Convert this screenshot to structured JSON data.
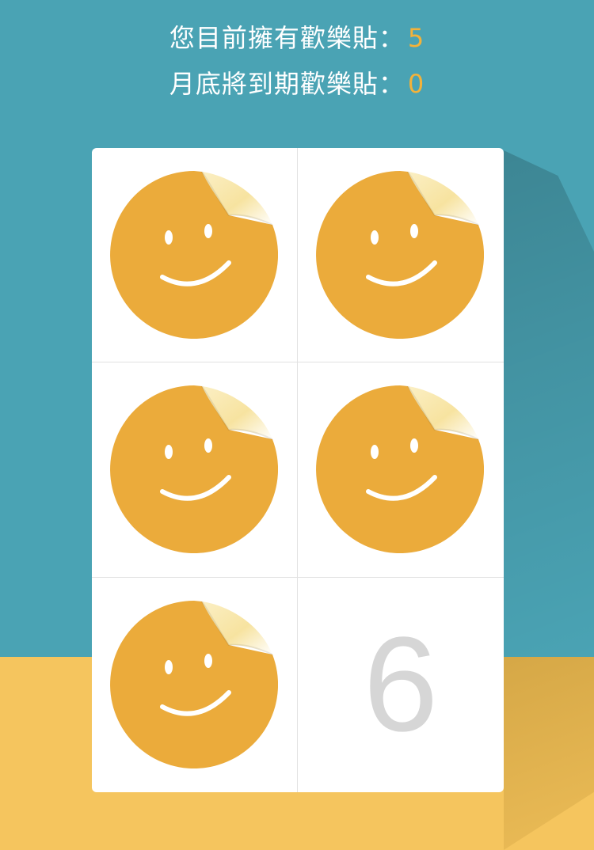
{
  "header": {
    "owned_label": "您目前擁有歡樂貼：",
    "owned_count": "5",
    "expiring_label": "月底將到期歡樂貼：",
    "expiring_count": "0"
  },
  "board": {
    "filled_stickers": 5,
    "empty_slots": [
      {
        "number": "6"
      }
    ]
  },
  "colors": {
    "background_top": "#4aa3b4",
    "background_bottom": "#f5c55e",
    "sticker": "#ebab3b",
    "accent_number": "#f3b23a"
  },
  "icons": {
    "sticker": "smiley-sticker-icon"
  }
}
